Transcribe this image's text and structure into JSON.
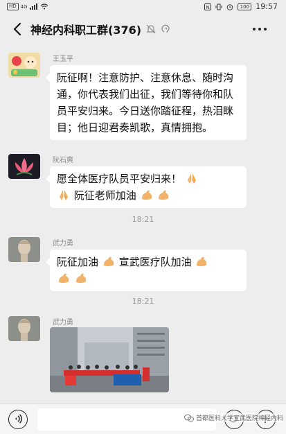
{
  "status_bar": {
    "left_tags": [
      "HD",
      "4G"
    ],
    "battery": "100",
    "time": "19:57"
  },
  "nav": {
    "title": "神经内科职工群(376)"
  },
  "messages": [
    {
      "sender": "王玉平",
      "text": "阮征啊！注意防护、注意休息、随时沟通，你代表我们出征，我们等待你和队员平安归来。今日送你踏征程，热泪眯目；他日迎君奏凯歌，真情拥抱。"
    },
    {
      "sender": "阮石爽",
      "text_a": "愿全体医疗队员平安归来！",
      "text_b": "阮征老师加油"
    },
    {
      "sender": "武力勇",
      "text_a": "阮征加油",
      "text_b": "宣武医疗队加油"
    },
    {
      "sender": "武力勇",
      "image_alt": "医疗队员合影"
    }
  ],
  "timestamps": [
    "18:21",
    "18:21"
  ],
  "watermark": "首都医科大学宣武医院神经内科",
  "colors": {
    "background": "#ededed",
    "bubble": "#ffffff",
    "muted_text": "#888888"
  }
}
